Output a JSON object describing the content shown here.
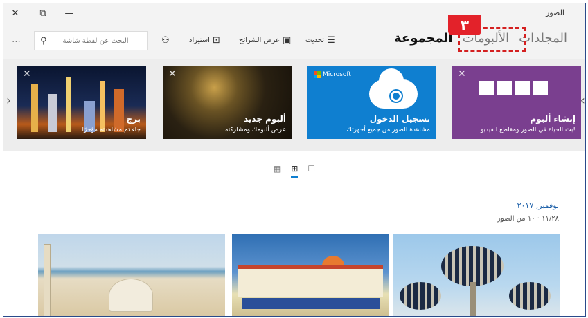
{
  "window": {
    "app_title": "الصور",
    "controls": {
      "close": "✕",
      "restore": "⧉",
      "minimize": "—"
    }
  },
  "tabs": [
    {
      "label": "المجموعة",
      "active": true
    },
    {
      "label": "الألبومات",
      "active": false
    },
    {
      "label": "المجلدات",
      "active": false
    }
  ],
  "annotation_badge": "٣",
  "toolbar": {
    "refresh_label": "تحديث",
    "slideshow_label": "عرض الشرائح",
    "import_label": "استيراد",
    "search_placeholder": "البحث عن لقطة شاشة",
    "more": "⋯"
  },
  "cards": [
    {
      "title": "إنشاء ألبوم",
      "subtitle": "بث الحياة في الصور ومقاطع الفيديو!",
      "color": "#7a3f8f"
    },
    {
      "title": "تسجيل الدخول",
      "subtitle": "مشاهدة الصور من جميع أجهزتك",
      "brand": "Microsoft",
      "color": "#0f7fd0"
    },
    {
      "title": "ألبوم جديد",
      "subtitle": "عرض ألبومك ومشاركته",
      "color": "#1c1710"
    },
    {
      "title": "برج",
      "subtitle": "جاء تم مشاهدته مؤخرًا",
      "color": "#0a1530"
    }
  ],
  "views": {
    "icons": [
      "list-view-icon",
      "grid-view-icon",
      "single-view-icon"
    ],
    "active": "grid-view-icon"
  },
  "gallery": {
    "date": "نوفمبر, ٢٠١٧",
    "count": "١١/٢٨ · ١٠ من الصور"
  },
  "accent_color": "#0f7fd0",
  "highlight_color": "#d42020"
}
